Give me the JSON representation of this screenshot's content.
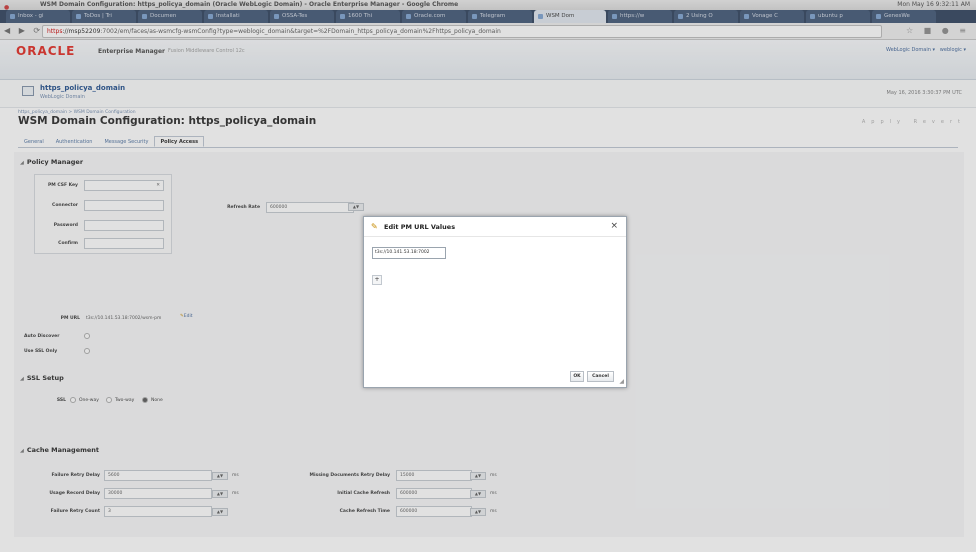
{
  "window": {
    "title": "WSM Domain Configuration: https_policya_domain (Oracle WebLogic Domain) - Oracle Enterprise Manager - Google Chrome",
    "system_tray": "Mon May 16 9:32:11 AM"
  },
  "browser": {
    "tabs": [
      {
        "label": "Inbox - gi"
      },
      {
        "label": "ToDos | Tri"
      },
      {
        "label": "Documen"
      },
      {
        "label": "Installati"
      },
      {
        "label": "OSSA-Tes"
      },
      {
        "label": "1600 Thi"
      },
      {
        "label": "Oracle.com"
      },
      {
        "label": "Telegram"
      },
      {
        "label": "WSM Dom",
        "active": true
      },
      {
        "label": "https://w"
      },
      {
        "label": "2 Using O"
      },
      {
        "label": "Vonage C"
      },
      {
        "label": "ubuntu p"
      },
      {
        "label": "GenesWe"
      }
    ],
    "url_scheme": "https",
    "url_host": "://msp52209",
    "url_rest": ":7002/em/faces/as-wsmcfg-wsmConfig?type=weblogic_domain&target=%2FDomain_https_policya_domain%2Fhttps_policya_domain"
  },
  "em": {
    "brand": "ORACLE",
    "product": "Enterprise Manager",
    "product_sub": "Fusion Middleware Control 12c",
    "menu_domain": "WebLogic Domain",
    "user": "weblogic"
  },
  "target": {
    "name": "https_policya_domain",
    "type": "WebLogic Domain",
    "refresh_time": "May 16, 2016 3:30:37 PM UTC"
  },
  "page": {
    "breadcrumb": "https_policya_domain > WSM Domain Configuration",
    "title": "WSM Domain Configuration: https_policya_domain",
    "actions": [
      "Apply",
      "Revert"
    ],
    "tabs": [
      "General",
      "Authentication",
      "Message Security",
      "Policy Access"
    ]
  },
  "policy_manager": {
    "title": "Policy Manager",
    "pm_csf_key_label": "PM CSF Key",
    "connector_label": "Connector",
    "password_label": "Password",
    "confirm_label": "Confirm",
    "refresh_rate_label": "Refresh Rate",
    "refresh_rate_value": "600000",
    "pm_url_label": "PM URL",
    "pm_url_value": "t3s://10.141.53.18:7002/wsm-pm",
    "edit_label": "Edit",
    "auto_discover_label": "Auto Discover",
    "use_ssl_only_label": "Use SSL Only"
  },
  "ssl_setup": {
    "title": "SSL Setup",
    "ssl_label": "SSL",
    "options": [
      "One-way",
      "Two-way",
      "None"
    ],
    "selected": "None"
  },
  "cache_management": {
    "title": "Cache Management",
    "failure_retry_delay_label": "Failure Retry Delay",
    "failure_retry_delay_value": "5600",
    "usage_record_delay_label": "Usage Record Delay",
    "usage_record_delay_value": "30000",
    "failure_retry_count_label": "Failure Retry Count",
    "failure_retry_count_value": "3",
    "missing_docs_retry_label": "Missing Documents Retry Delay",
    "missing_docs_retry_value": "15000",
    "initial_cache_refresh_label": "Initial Cache Refresh",
    "initial_cache_refresh_value": "600000",
    "cache_refresh_time_label": "Cache Refresh Time",
    "cache_refresh_time_value": "600000",
    "unit_ms": "ms"
  },
  "dialog": {
    "title": "Edit PM URL Values",
    "url_value": "t3s://10.141.53.18:7002",
    "ok_label": "OK",
    "cancel_label": "Cancel",
    "add_symbol": "+",
    "close_symbol": "×"
  }
}
